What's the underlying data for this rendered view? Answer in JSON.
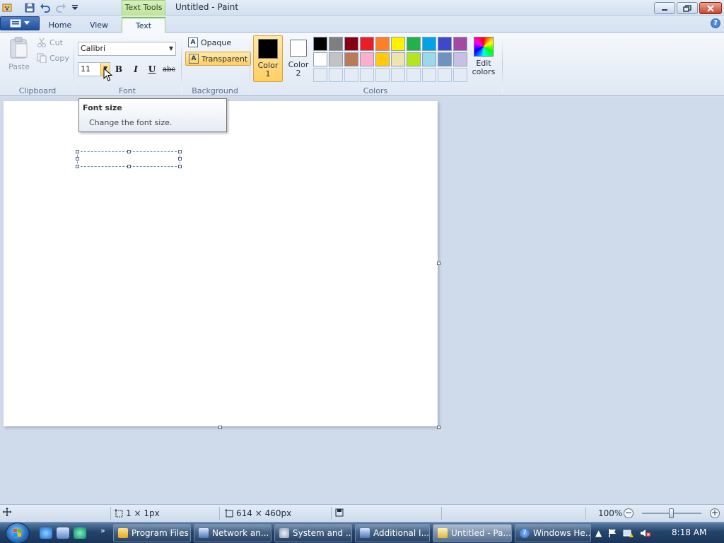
{
  "window": {
    "title": "Untitled - Paint",
    "context_tab": "Text Tools"
  },
  "tabs": [
    {
      "label": "Home"
    },
    {
      "label": "View"
    },
    {
      "label": "Text"
    }
  ],
  "ribbon": {
    "clipboard": {
      "label": "Clipboard",
      "paste": "Paste",
      "cut": "Cut",
      "copy": "Copy"
    },
    "font": {
      "label": "Font",
      "family": "Calibri",
      "size": "11",
      "bold": "B",
      "italic": "I",
      "underline": "U",
      "strikethrough": "abc"
    },
    "background": {
      "label": "Background",
      "opaque": "Opaque",
      "transparent": "Transparent"
    },
    "colors": {
      "label": "Colors",
      "color1_line1": "Color",
      "color1_line2": "1",
      "color2_line1": "Color",
      "color2_line2": "2",
      "edit_line1": "Edit",
      "edit_line2": "colors",
      "color1": "#000000",
      "color2": "#ffffff",
      "palette_row1": [
        "#000000",
        "#7f7f7f",
        "#880015",
        "#ed1c24",
        "#ff7f27",
        "#fff200",
        "#22b14c",
        "#00a2e8",
        "#3f48cc",
        "#a349a4"
      ],
      "palette_row2": [
        "#ffffff",
        "#c3c3c3",
        "#b97a57",
        "#ffaec9",
        "#ffc90e",
        "#efe4b0",
        "#b5e61d",
        "#99d9ea",
        "#7092be",
        "#c8bfe7"
      ]
    }
  },
  "tooltip": {
    "title": "Font size",
    "description": "Change the font size."
  },
  "statusbar": {
    "selection_size": "1 × 1px",
    "canvas_size": "614 × 460px",
    "zoom": "100%"
  },
  "taskbar": {
    "items": [
      {
        "label": "Program Files"
      },
      {
        "label": "Network an..."
      },
      {
        "label": "System and ..."
      },
      {
        "label": "Additional I..."
      },
      {
        "label": "Untitled - Pa..."
      },
      {
        "label": "Windows He..."
      }
    ],
    "clock": "8:18 AM"
  }
}
